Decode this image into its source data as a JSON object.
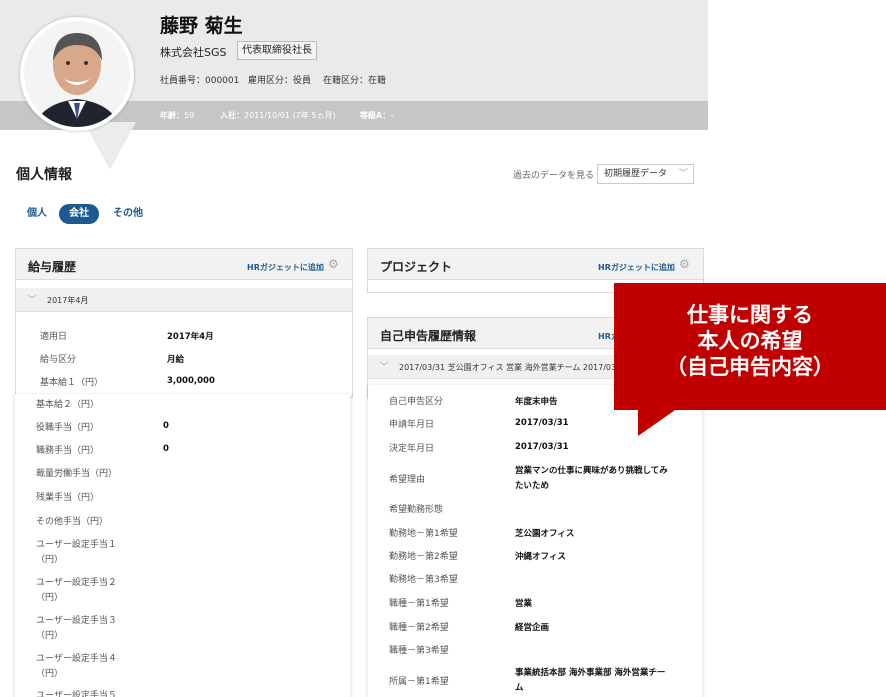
{
  "profile": {
    "name": "藤野 菊生",
    "company": "株式会社SGS",
    "title": "代表取締役社長",
    "employee_no": "社員番号：000001",
    "employment_type": "雇用区分：役員",
    "status": "在籍区分：在籍",
    "age_label": "年齢：",
    "age": "59",
    "joined_label": "入社：",
    "joined": "2011/10/01 (7年 5ヵ月)",
    "grade_label": "等級A：",
    "grade": "–"
  },
  "section": {
    "title": "個人情報",
    "history_label": "過去のデータを見る",
    "history_select": "初期履歴データ"
  },
  "tabs": [
    {
      "label": "個人"
    },
    {
      "label": "会社"
    },
    {
      "label": "その他"
    }
  ],
  "salary_panel": {
    "title": "給与履歴",
    "add_label": "HRガジェットに追加",
    "sub_head": "2017年4月",
    "rows": [
      {
        "label": "適用日",
        "value": "2017年4月"
      },
      {
        "label": "給与区分",
        "value": "月給"
      },
      {
        "label": "基本給１（円）",
        "value": "3,000,000"
      }
    ],
    "sheet_rows": [
      {
        "label": "基本給２（円）",
        "value": ""
      },
      {
        "label": "役職手当（円）",
        "value": "0"
      },
      {
        "label": "職務手当（円）",
        "value": "0"
      },
      {
        "label": "裁量労働手当（円）",
        "value": ""
      },
      {
        "label": "残業手当（円）",
        "value": ""
      },
      {
        "label": "その他手当（円）",
        "value": ""
      },
      {
        "label": "ユーザー設定手当１",
        "label2": "（円）",
        "value": ""
      },
      {
        "label": "ユーザー設定手当２",
        "label2": "（円）",
        "value": ""
      },
      {
        "label": "ユーザー設定手当３",
        "label2": "（円）",
        "value": ""
      },
      {
        "label": "ユーザー設定手当４",
        "label2": "（円）",
        "value": ""
      },
      {
        "label": "ユーザー設定手当５",
        "value": ""
      }
    ]
  },
  "project_panel": {
    "title": "プロジェクト",
    "add_label": "HRガジェットに追加"
  },
  "self_report_panel": {
    "title": "自己申告履歴情報",
    "add_label": "HRガ",
    "sub_head": "2017/03/31 芝公園オフィス 営業 海外営業チーム 2017/03/",
    "rows": [
      {
        "label": "自己申告区分",
        "value": "年度末申告"
      },
      {
        "label": "申請年月日",
        "value": "2017/03/31"
      },
      {
        "label": "決定年月日",
        "value": "2017/03/31"
      },
      {
        "label": "希望理由",
        "value": "営業マンの仕事に興味があり挑戦してみ",
        "value2": "たいため"
      },
      {
        "label": "希望勤務形態",
        "value": ""
      },
      {
        "label": "勤務地－第1希望",
        "value": "芝公園オフィス"
      },
      {
        "label": "勤務地－第2希望",
        "value": "沖縄オフィス"
      },
      {
        "label": "勤務地－第3希望",
        "value": ""
      },
      {
        "label": "職種－第1希望",
        "value": "営業"
      },
      {
        "label": "職種－第2希望",
        "value": "経営企画"
      },
      {
        "label": "職種－第3希望",
        "value": ""
      },
      {
        "label": "所属－第1希望",
        "value": "事業統括本部 海外事業部 海外営業チー",
        "value2": "ム"
      }
    ]
  },
  "callout": {
    "line1": "仕事に関する",
    "line2": "本人の希望",
    "line3": "（自己申告内容）"
  }
}
